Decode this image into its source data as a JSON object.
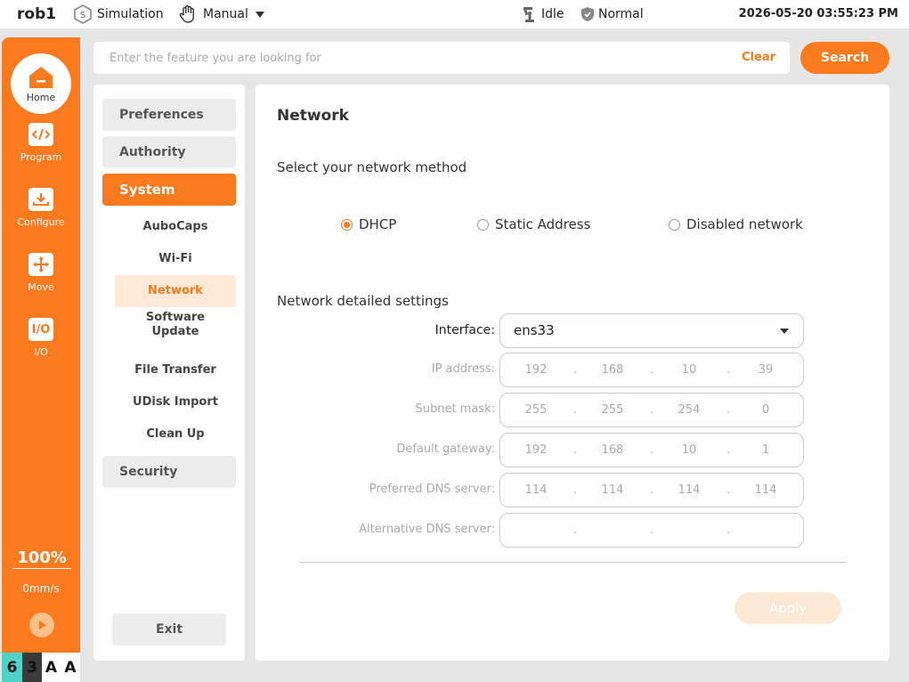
{
  "topbar": {
    "robot_name": "rob1",
    "simulation_label": "Simulation",
    "mode_label": "Manual",
    "state_label": "Idle",
    "safety_label": "Normal",
    "datetime": "2026-05-20 03:55:23 PM"
  },
  "nav": {
    "home": "Home",
    "program": "Program",
    "configure": "Configure",
    "move": "Move",
    "io": "I/O",
    "io_icon_text": "I/O",
    "speed_percent": "100%",
    "speed_value": "0mm/s"
  },
  "status_boxes": [
    "6",
    "3",
    "A",
    "A"
  ],
  "search": {
    "placeholder": "Enter the feature you are looking for",
    "value": "",
    "clear_label": "Clear",
    "search_label": "Search"
  },
  "menu": {
    "preferences": "Preferences",
    "authority": "Authority",
    "system": "System",
    "sub": {
      "aubocaps": "AuboCaps",
      "wifi": "Wi-Fi",
      "network": "Network",
      "software_update": "Software Update",
      "file_transfer": "File Transfer",
      "udisk_import": "UDisk Import",
      "clean_up": "Clean Up"
    },
    "security": "Security",
    "exit": "Exit"
  },
  "network": {
    "title": "Network",
    "method_label": "Select your network method",
    "methods": {
      "dhcp": "DHCP",
      "static": "Static Address",
      "disabled": "Disabled network"
    },
    "selected_method": "DHCP",
    "details_label": "Network detailed settings",
    "interface_label": "Interface:",
    "interface_value": "ens33",
    "ip_label": "IP address:",
    "ip": [
      "192",
      "168",
      "10",
      "39"
    ],
    "mask_label": "Subnet mask:",
    "mask": [
      "255",
      "255",
      "254",
      "0"
    ],
    "gateway_label": "Default gateway:",
    "gateway": [
      "192",
      "168",
      "10",
      "1"
    ],
    "dns1_label": "Preferred DNS server:",
    "dns1": [
      "114",
      "114",
      "114",
      "114"
    ],
    "dns2_label": "Alternative DNS server:",
    "dns2": [
      "",
      "",
      "",
      ""
    ],
    "apply_label": "Apply"
  },
  "colors": {
    "accent": "#fc7a1e",
    "accent_light": "#fde9d6",
    "status_teal": "#4fd2c8"
  }
}
